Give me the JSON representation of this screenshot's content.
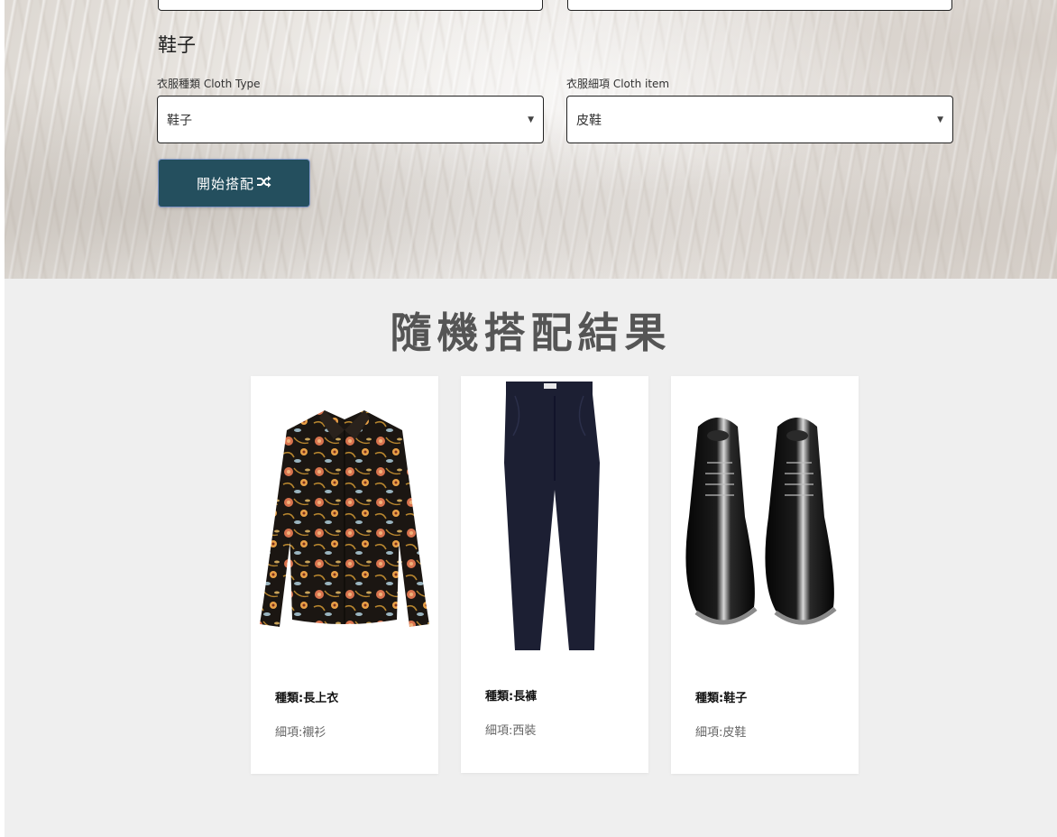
{
  "form": {
    "section_title": "鞋子",
    "cloth_type_label": "衣服種類 Cloth Type",
    "cloth_type_value": "鞋子",
    "cloth_item_label": "衣服細項 Cloth item",
    "cloth_item_value": "皮鞋",
    "select_arrow": "▼",
    "start_button_label": "開始搭配",
    "start_button_icon": "shuffle-icon",
    "start_button_color": "#244f5e"
  },
  "results": {
    "title": "隨機搭配結果",
    "background": "#efefef",
    "items": [
      {
        "type": "種類:長上衣",
        "detail": "細項:襯衫",
        "image": "floral-shirt-image"
      },
      {
        "type": "種類:長褲",
        "detail": "細項:西裝",
        "image": "navy-trousers-image"
      },
      {
        "type": "種類:鞋子",
        "detail": "細項:皮鞋",
        "image": "black-leather-shoes-image"
      }
    ]
  }
}
